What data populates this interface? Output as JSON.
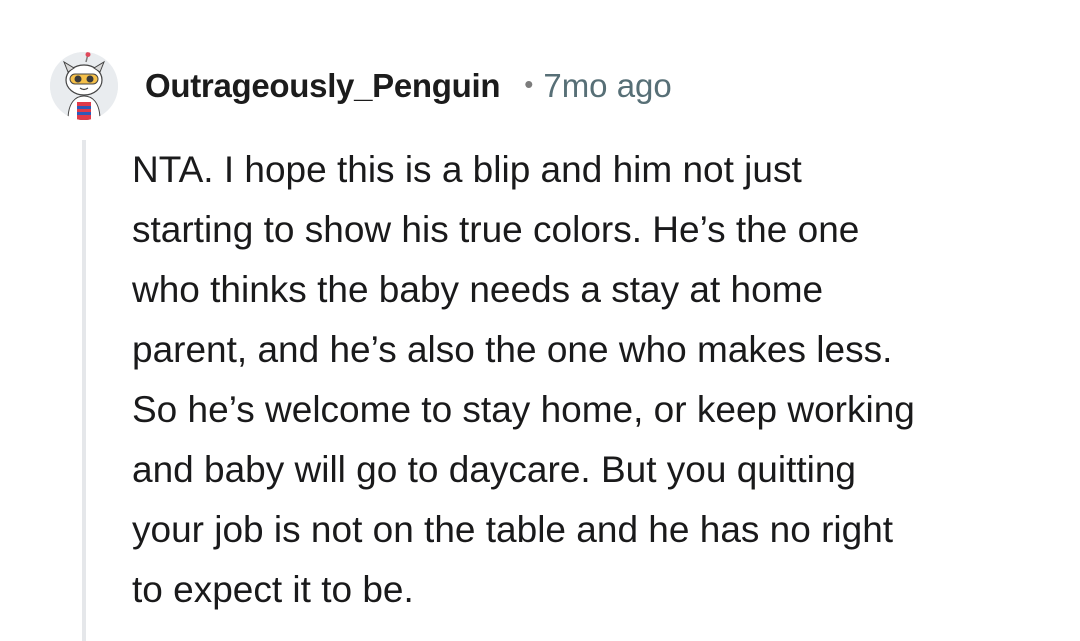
{
  "comment": {
    "author": "Outrageously_Penguin",
    "separator": "•",
    "age": "7mo ago",
    "avatar_icon": "snoo-avatar-icon",
    "body_lines": [
      "NTA. I hope this is a blip and him not just",
      "starting to show his true colors. He’s the one",
      "who thinks the baby needs a stay at home",
      "parent, and he’s also the one who makes less.",
      "So he’s welcome to stay home, or keep working",
      "and baby will go to daycare. But you quitting",
      "your job is not on the table and he has no right",
      "to expect it to be."
    ]
  }
}
